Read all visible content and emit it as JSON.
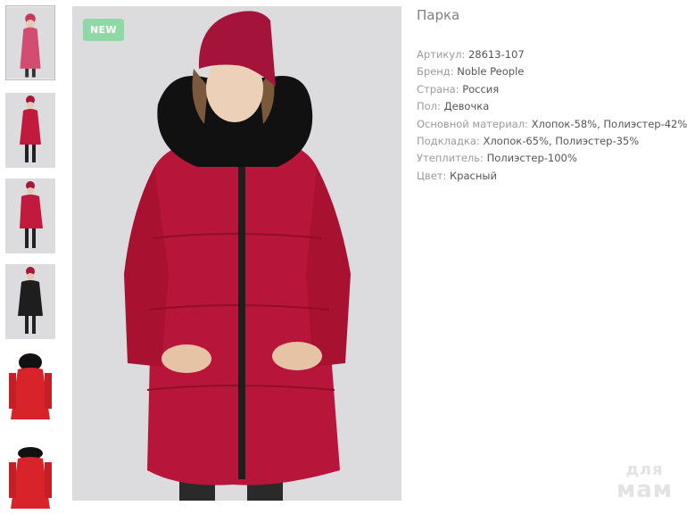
{
  "product": {
    "title": "Парка",
    "badge": "NEW",
    "accent_color": "#c21a3c",
    "badge_color": "#8fd9a8",
    "specs": [
      {
        "label": "Артикул:",
        "value": "28613-107"
      },
      {
        "label": "Бренд:",
        "value": "Noble People"
      },
      {
        "label": "Страна:",
        "value": "Россия"
      },
      {
        "label": "Пол:",
        "value": "Девочка"
      },
      {
        "label": "Основной материал:",
        "value": "Хлопок-58%, Полиэстер-42%"
      },
      {
        "label": "Подкладка:",
        "value": "Хлопок-65%, Полиэстер-35%"
      },
      {
        "label": "Утеплитель:",
        "value": "Полиэстер-100%"
      },
      {
        "label": "Цвет:",
        "value": "Красный"
      }
    ]
  },
  "gallery": {
    "thumbnails": [
      {
        "name": "front-pink",
        "active": true
      },
      {
        "name": "front-red"
      },
      {
        "name": "side-red"
      },
      {
        "name": "front-black"
      },
      {
        "name": "back-red-flat"
      },
      {
        "name": "front-red-flat"
      }
    ]
  },
  "watermark": {
    "line1": "для",
    "line2": "мам"
  }
}
